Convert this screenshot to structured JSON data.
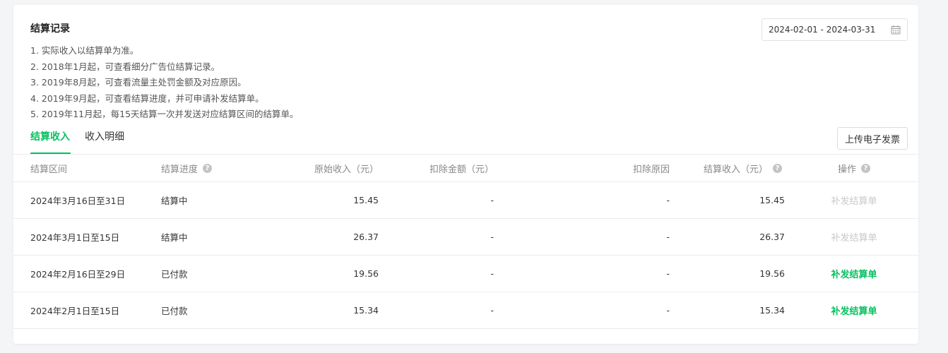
{
  "section": {
    "title": "结算记录",
    "notes": [
      "1. 实际收入以结算单为准。",
      "2. 2018年1月起，可查看细分广告位结算记录。",
      "3. 2019年8月起，可查看流量主处罚金额及对应原因。",
      "4. 2019年9月起，可查看结算进度，并可申请补发结算单。",
      "5. 2019年11月起，每15天结算一次并发送对应结算区间的结算单。"
    ]
  },
  "date_range": {
    "value": "2024-02-01 - 2024-03-31",
    "icon": "calendar-icon"
  },
  "tabs": [
    {
      "label": "结算收入",
      "active": true
    },
    {
      "label": "收入明细",
      "active": false
    }
  ],
  "upload_button": "上传电子发票",
  "accent_color": "#07c160",
  "table": {
    "headers": {
      "period": "结算区间",
      "progress": "结算进度",
      "original": "原始收入（元）",
      "deduction": "扣除金额（元）",
      "reason": "扣除原因",
      "settled": "结算收入（元）",
      "action": "操作"
    },
    "help_glyph": "?",
    "rows": [
      {
        "period": "2024年3月16日至31日",
        "progress": "结算中",
        "original": "15.45",
        "deduction": "-",
        "reason": "-",
        "settled": "15.45",
        "action": "补发结算单",
        "action_enabled": false
      },
      {
        "period": "2024年3月1日至15日",
        "progress": "结算中",
        "original": "26.37",
        "deduction": "-",
        "reason": "-",
        "settled": "26.37",
        "action": "补发结算单",
        "action_enabled": false
      },
      {
        "period": "2024年2月16日至29日",
        "progress": "已付款",
        "original": "19.56",
        "deduction": "-",
        "reason": "-",
        "settled": "19.56",
        "action": "补发结算单",
        "action_enabled": true
      },
      {
        "period": "2024年2月1日至15日",
        "progress": "已付款",
        "original": "15.34",
        "deduction": "-",
        "reason": "-",
        "settled": "15.34",
        "action": "补发结算单",
        "action_enabled": true
      }
    ]
  }
}
